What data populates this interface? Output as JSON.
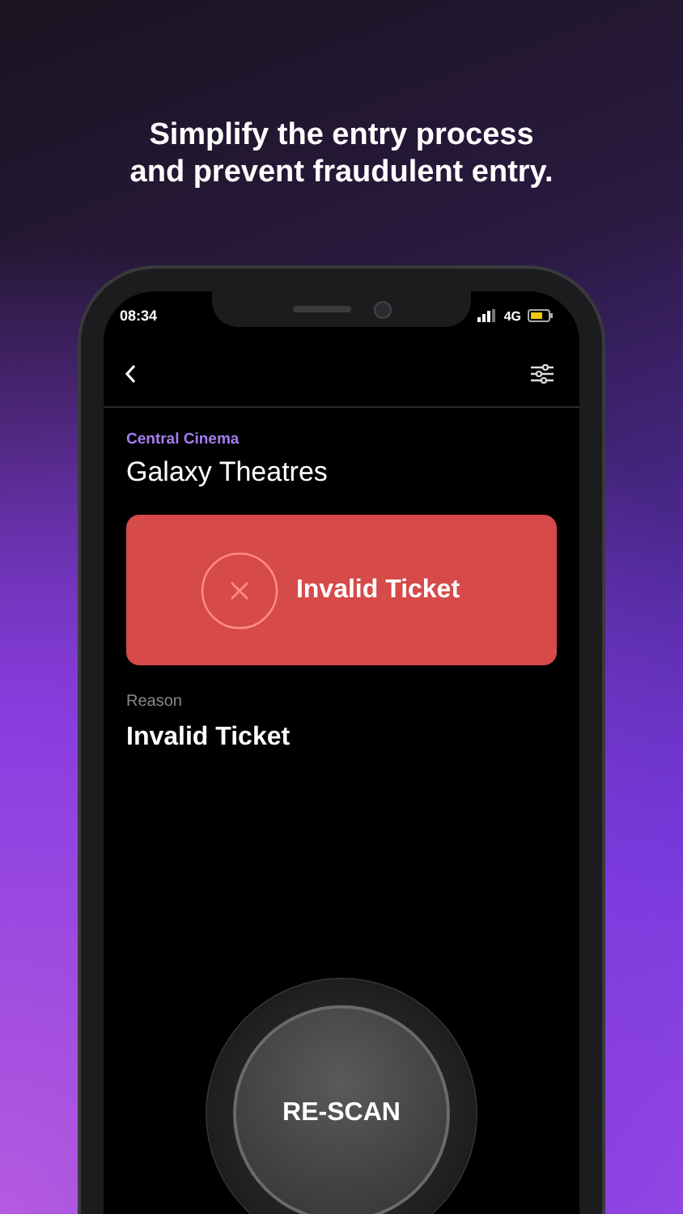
{
  "headline": [
    "Simplify the entry process",
    "and prevent fraudulent entry."
  ],
  "status_bar": {
    "time": "08:34",
    "network": "4G"
  },
  "venue": {
    "label": "Central Cinema",
    "name": "Galaxy Theatres"
  },
  "result": {
    "kind": "invalid",
    "text": "Invalid Ticket"
  },
  "reason": {
    "label": "Reason",
    "value": "Invalid Ticket"
  },
  "action_button": {
    "label": "RE-SCAN"
  }
}
